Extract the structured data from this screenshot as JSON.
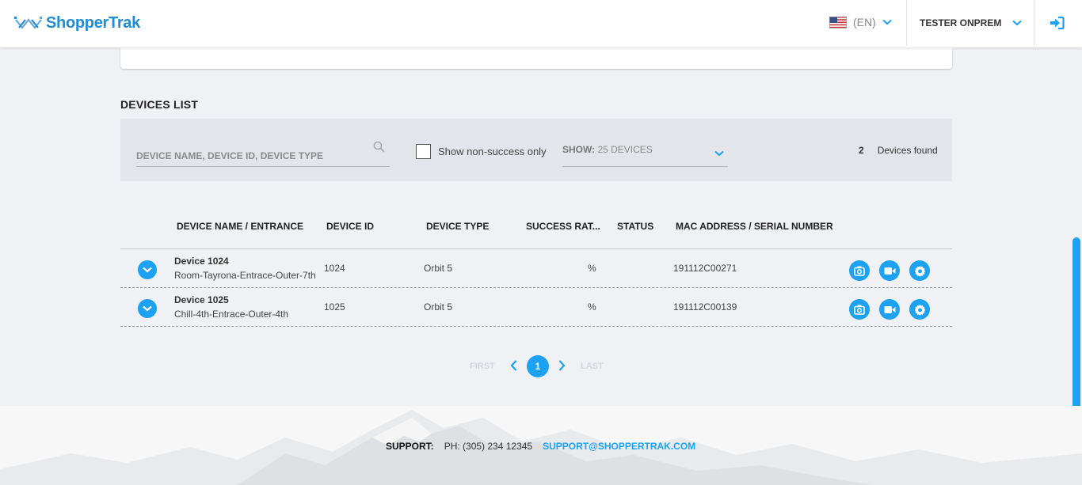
{
  "header": {
    "brand": "ShopperTrak",
    "language": "(EN)",
    "user": "TESTER ONPREM"
  },
  "devices": {
    "title": "DEVICES LIST",
    "search_placeholder": "DEVICE NAME, DEVICE ID, DEVICE TYPE",
    "non_success_label": "Show non-success only",
    "show_label": "SHOW:",
    "show_value": "25 DEVICES",
    "found_count": "2",
    "found_label": "Devices found",
    "columns": [
      "DEVICE NAME / ENTRANCE",
      "DEVICE ID",
      "DEVICE TYPE",
      "SUCCESS RAT...",
      "STATUS",
      "MAC ADDRESS / SERIAL NUMBER"
    ],
    "rows": [
      {
        "name": "Device 1024",
        "entrance": "Room-Tayrona-Entrace-Outer-7th",
        "id": "1024",
        "type": "Orbit 5",
        "success": "%",
        "status": "",
        "mac": "191112C00271"
      },
      {
        "name": "Device 1025",
        "entrance": "Chill-4th-Entrace-Outer-4th",
        "id": "1025",
        "type": "Orbit 5",
        "success": "%",
        "status": "",
        "mac": "191112C00139"
      }
    ]
  },
  "pagination": {
    "first": "FIRST",
    "current": "1",
    "last": "LAST"
  },
  "footer": {
    "support_label": "SUPPORT:",
    "phone": "PH: (305) 234 12345",
    "email": "SUPPORT@SHOPPERTRAK.COM"
  },
  "colors": {
    "accent": "#1da1f2",
    "brand": "#1f8dd6"
  }
}
